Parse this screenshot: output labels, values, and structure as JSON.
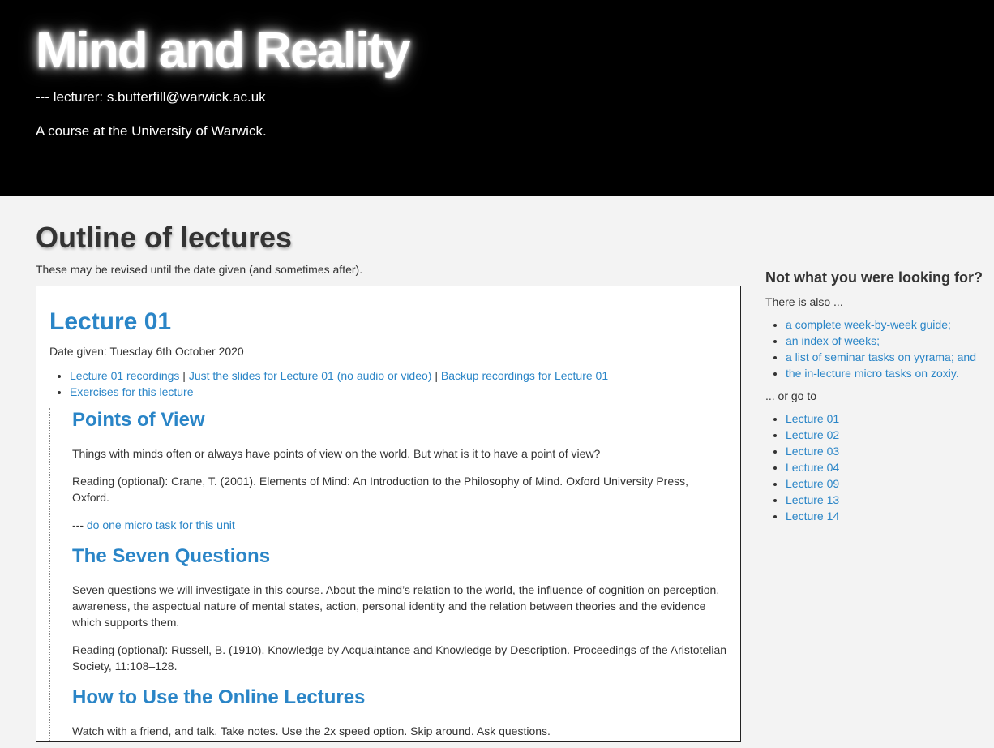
{
  "header": {
    "site_title": "Mind and Reality",
    "lecturer": "--- lecturer: s.butterfill@warwick.ac.uk",
    "course_description": "A course at the University of Warwick."
  },
  "main": {
    "page_title": "Outline of lectures",
    "intro": "These may be revised until the date given (and sometimes after).",
    "lecture": {
      "title": "Lecture 01",
      "date_given": "Date given: Tuesday 6th October 2020",
      "links": {
        "recordings": "Lecture 01 recordings",
        "sep1": " | ",
        "slides": "Just the slides for Lecture 01 (no audio or video)",
        "sep2": " | ",
        "backup": "Backup recordings for Lecture 01",
        "exercises": "Exercises for this lecture"
      },
      "units": [
        {
          "title": "Points of View",
          "description": "Things with minds often or always have points of view on the world. But what is it to have a point of view?",
          "reading": "Reading (optional): Crane, T. (2001). Elements of Mind: An Introduction to the Philosophy of Mind. Oxford University Press, Oxford.",
          "micro_prefix": "--- ",
          "micro_link": "do one micro task for this unit"
        },
        {
          "title": "The Seven Questions",
          "description": "Seven questions we will investigate in this course. About the mind’s relation to the world, the influence of cognition on perception, awareness, the aspectual nature of mental states, action, personal identity and the relation between theories and the evidence which supports them.",
          "reading": "Reading (optional): Russell, B. (1910). Knowledge by Acquaintance and Knowledge by Description. Proceedings of the Aristotelian Society, 11:108–128."
        },
        {
          "title": "How to Use the Online Lectures",
          "description": "Watch with a friend, and talk. Take notes. Use the 2x speed option. Skip around. Ask questions."
        }
      ]
    }
  },
  "sidebar": {
    "title": "Not what you were looking for?",
    "also_text": "There is also ...",
    "also_links": [
      "a complete week-by-week guide;",
      "an index of weeks;",
      "a list of seminar tasks on yyrama; and",
      "the in-lecture micro tasks on zoxiy."
    ],
    "goto_text": "... or go to",
    "lecture_links": [
      "Lecture 01",
      "Lecture 02",
      "Lecture 03",
      "Lecture 04",
      "Lecture 09",
      "Lecture 13",
      "Lecture 14"
    ]
  },
  "colors": {
    "link": "#2a85c7",
    "header_bg": "#000000",
    "page_bg": "#f3f3f3"
  }
}
